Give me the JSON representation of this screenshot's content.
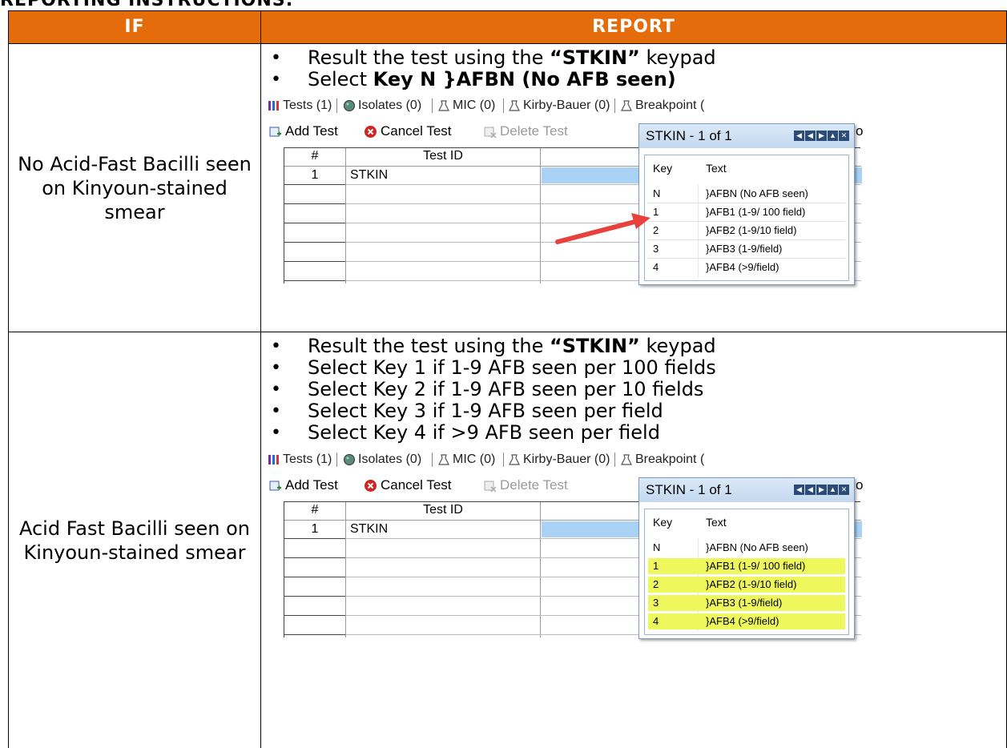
{
  "clipped_heading": "REPORTING INSTRUCTIONS:",
  "header": {
    "if": "IF",
    "report": "REPORT"
  },
  "rows": [
    {
      "condition": "No Acid-Fast Bacilli seen on Kinyoun-stained smear",
      "bullets": [
        {
          "pre": "Result the test using the ",
          "bold": "“STKIN”",
          "post": " keypad"
        },
        {
          "pre": "Select ",
          "bold": "Key N }AFBN (No AFB seen)",
          "post": ""
        }
      ]
    },
    {
      "condition": "Acid Fast Bacilli seen on Kinyoun-stained smear",
      "bullets": [
        {
          "pre": "Result the test using the ",
          "bold": "“STKIN”",
          "post": " keypad"
        },
        {
          "pre": "Select Key 1 if 1-9 AFB seen per 100 fields",
          "bold": "",
          "post": ""
        },
        {
          "pre": "Select Key 2 if 1-9 AFB seen per 10 fields",
          "bold": "",
          "post": ""
        },
        {
          "pre": "Select Key 3 if 1-9 AFB seen per field",
          "bold": "",
          "post": ""
        },
        {
          "pre": "Select Key 4 if >9 AFB seen per field",
          "bold": "",
          "post": ""
        }
      ]
    }
  ],
  "screenshot": {
    "tabs": [
      "Tests (1)",
      "Isolates (0)",
      "MIC (0)",
      "Kirby-Bauer (0)",
      "Breakpoint ("
    ],
    "toolbar": {
      "add": "Add Test",
      "cancel": "Cancel Test",
      "delete": "Delete Test",
      "overflow": "o"
    },
    "grid": {
      "col_num": "#",
      "col_test": "Test ID",
      "row_num": "1",
      "row_test": "STKIN"
    },
    "popup": {
      "title": "STKIN - 1 of 1",
      "col_key": "Key",
      "col_text": "Text",
      "items": [
        {
          "key": "N",
          "text": "}AFBN (No AFB seen)"
        },
        {
          "key": "1",
          "text": "}AFB1 (1-9/ 100 field)"
        },
        {
          "key": "2",
          "text": "}AFB2 (1-9/10 field)"
        },
        {
          "key": "3",
          "text": "}AFB3 (1-9/field)"
        },
        {
          "key": "4",
          "text": "}AFB4 (>9/field)"
        }
      ]
    }
  },
  "colors": {
    "header_bg": "#E46C0A",
    "selection": "#A9D2F5",
    "highlight": "#EEF85C",
    "arrow": "#E8403A"
  }
}
